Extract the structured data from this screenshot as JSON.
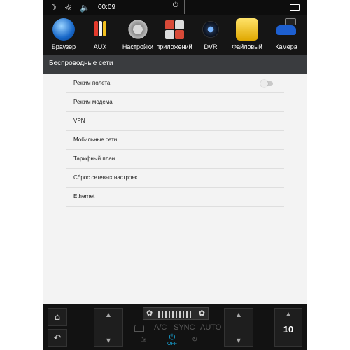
{
  "status_bar": {
    "time": "00:09"
  },
  "apps": [
    {
      "label": "Браузер",
      "icon": "browser-globe-icon"
    },
    {
      "label": "AUX",
      "icon": "aux-cable-icon"
    },
    {
      "label": "Настройки",
      "icon": "settings-gear-icon"
    },
    {
      "label": "приложений",
      "icon": "apps-grid-icon"
    },
    {
      "label": "DVR",
      "icon": "dvr-lens-icon"
    },
    {
      "label": "Файловый",
      "icon": "file-manager-folder-icon"
    },
    {
      "label": "Камера",
      "icon": "camera-car-icon"
    }
  ],
  "header": {
    "title": "Беспроводные сети"
  },
  "settings": [
    {
      "label": "Режим полета",
      "has_toggle": true,
      "toggle_on": false
    },
    {
      "label": "Режим модема"
    },
    {
      "label": "VPN"
    },
    {
      "label": "Мобильные сети"
    },
    {
      "label": "Тарифный план"
    },
    {
      "label": "Сброс сетевых настроек"
    },
    {
      "label": "Ethernet"
    }
  ],
  "climate": {
    "ac_label": "A/C",
    "sync_label": "SYNC",
    "auto_label": "AUTO",
    "power_label": "OFF",
    "right_value": "10",
    "power_color": "#17a4d6"
  }
}
